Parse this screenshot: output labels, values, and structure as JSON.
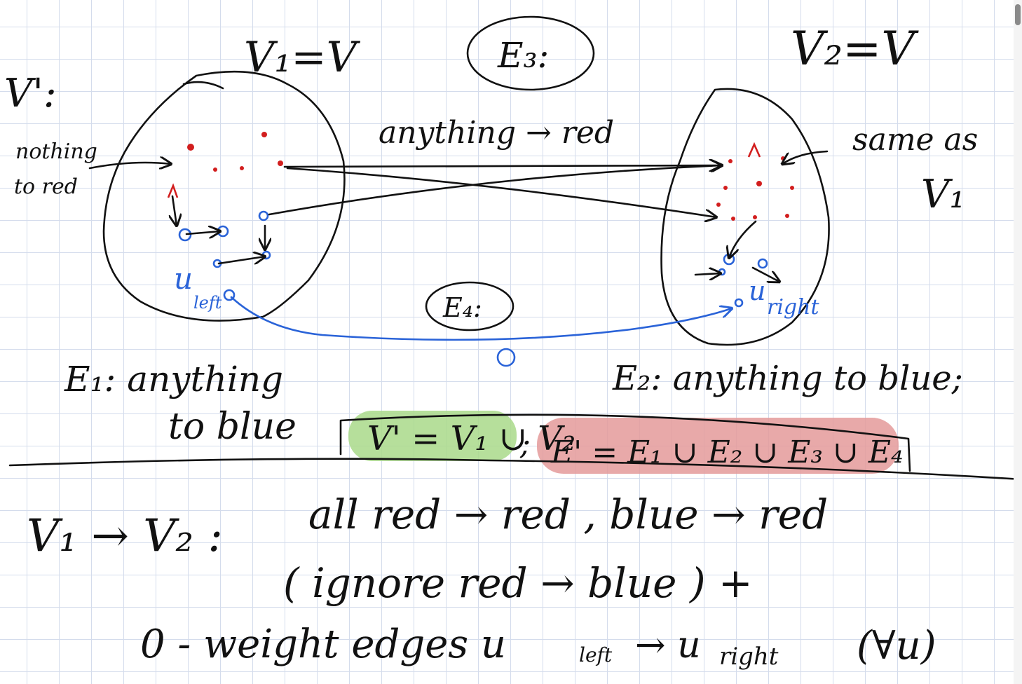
{
  "labels": {
    "v_prime": "V':",
    "v1_def": "V₁=V",
    "v2_def": "V₂=V",
    "e3": "E₃:",
    "e4": "E₄:",
    "nothing_to_red_1": "nothing",
    "nothing_to_red_2": "to red",
    "anything_to_red": "anything → red",
    "same_as_1": "same as",
    "same_as_2": "V₁",
    "u_left": "u",
    "u_left_sub": "left",
    "u_right": "u",
    "u_right_sub": "right",
    "zero_mark": "0",
    "e1_line1": "E₁: anything",
    "e1_line2": "to blue",
    "e2": "E₂: anything to blue;",
    "v_prime_union": "V' = V₁ ∪ V₂",
    "separator": ";",
    "e_prime_union": "E' = E₁ ∪ E₂ ∪ E₃ ∪ E₄",
    "v1_to_v2": "V₁ → V₂ :",
    "all_edges": "all  red → red ,  blue → red",
    "ignore": "( ignore   red → blue ) +",
    "zero_weight": "0 - weight  edges  u",
    "zero_weight_left": "left",
    "zero_weight_arrow": "→ u",
    "zero_weight_right": "right",
    "for_all_u": "(∀u)"
  },
  "colors": {
    "ink": "#111111",
    "red": "#d21e1e",
    "blue": "#2a63d8",
    "green_highlight": "#a9d98a",
    "red_highlight": "#e49a9a",
    "grid": "#d4dcec"
  }
}
